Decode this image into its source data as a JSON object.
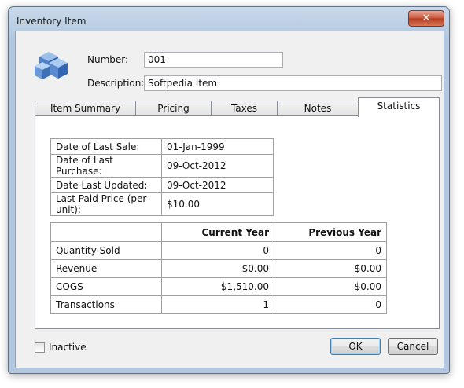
{
  "window": {
    "title": "Inventory Item",
    "close_glyph": "✕"
  },
  "header": {
    "number_label": "Number:",
    "number_value": "001",
    "description_label": "Description:",
    "description_value": "Softpedia Item",
    "icon": "inventory-cubes-icon"
  },
  "tabs": [
    {
      "label": "Item Summary",
      "active": false
    },
    {
      "label": "Pricing",
      "active": false
    },
    {
      "label": "Taxes",
      "active": false
    },
    {
      "label": "Notes",
      "active": false
    },
    {
      "label": "Statistics",
      "active": true
    }
  ],
  "info": [
    {
      "label": "Date of Last Sale:",
      "value": "01-Jan-1999"
    },
    {
      "label": "Date of Last Purchase:",
      "value": "09-Oct-2012"
    },
    {
      "label": "Date Last Updated:",
      "value": "09-Oct-2012"
    },
    {
      "label": "Last Paid Price (per unit):",
      "value": "$10.00"
    }
  ],
  "stats": {
    "headers": [
      "",
      "Current Year",
      "Previous Year"
    ],
    "rows": [
      {
        "label": "Quantity Sold",
        "current": "0",
        "previous": "0"
      },
      {
        "label": "Revenue",
        "current": "$0.00",
        "previous": "$0.00"
      },
      {
        "label": "COGS",
        "current": "$1,510.00",
        "previous": "$0.00"
      },
      {
        "label": "Transactions",
        "current": "1",
        "previous": "0"
      }
    ]
  },
  "footer": {
    "inactive_label": "Inactive",
    "inactive_checked": false,
    "ok_label": "OK",
    "cancel_label": "Cancel"
  },
  "colors": {
    "accent": "#3c7fb1",
    "title_bar": "#b3c8de",
    "close_button": "#c8563b"
  }
}
